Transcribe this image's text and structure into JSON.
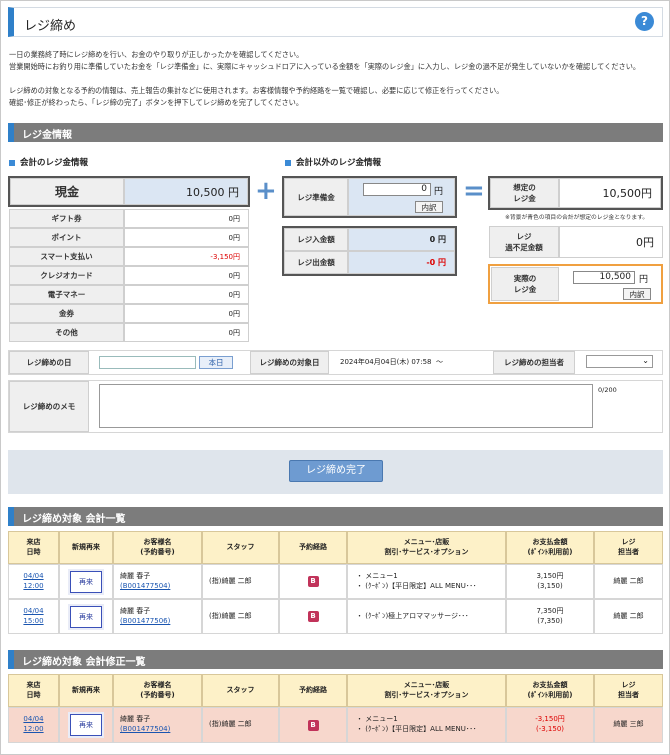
{
  "title": "レジ締め",
  "intro": [
    "一日の業務終了時にレジ締めを行い、お金のやり取りが正しかったかを確認してください。",
    "営業開始時にお釣り用に準備していたお金を「レジ準備金」に、実際にキャッシュドロアに入っている金額を「実際のレジ金」に入力し、レジ金の過不足が発生していないかを確認してください。",
    "レジ締めの対象となる予約の情報は、売上報告の集計などに使用されます。お客様情報や予約経路を一覧で確認し、必要に応じて修正を行ってください。",
    "確認･修正が終わったら、「レジ締の完了」ボタンを押下してレジ締めを完了してください。"
  ],
  "register_section": {
    "title": "レジ金情報",
    "accounting_title": "会計のレジ金情報",
    "non_accounting_title": "会計以外のレジ金情報",
    "cash_label": "現金",
    "cash_value": "10,500 円",
    "rows": [
      {
        "label": "ギフト券",
        "value": "0円"
      },
      {
        "label": "ポイント",
        "value": "0円"
      },
      {
        "label": "スマート支払い",
        "value": "-3,150円"
      },
      {
        "label": "クレジオカード",
        "value": "0円"
      },
      {
        "label": "電子マネー",
        "value": "0円"
      },
      {
        "label": "金券",
        "value": "0円"
      },
      {
        "label": "その他",
        "value": "0円"
      }
    ],
    "prep_label": "レジ準備金",
    "prep_value": "0",
    "yen": "円",
    "breakdown_label": "内訳",
    "deposit_label": "レジ入金額",
    "deposit_value": "0 円",
    "withdraw_label": "レジ出金額",
    "withdraw_value": "-0 円",
    "expected_label": "想定の\nレジ金",
    "expected_value": "10,500円",
    "expected_note": "※背景が青色の項目の合計が想定のレジ金となります。",
    "diff_label": "レジ\n過不足金額",
    "diff_value": "0円",
    "actual_label": "実際の\nレジ金",
    "actual_value": "10,500"
  },
  "close_info": {
    "date_label": "レジ締めの日",
    "date_value": "",
    "today_button": "本日",
    "target_label": "レジ締めの対象日",
    "target_value": "2024年04月04日(木) 07:58  ～",
    "staff_label": "レジ締めの担当者",
    "staff_value": "",
    "memo_label": "レジ締めのメモ",
    "memo_counter": "0/200"
  },
  "complete_button": "レジ締め完了",
  "list1": {
    "title": "レジ締め対象 会計一覧",
    "headers": [
      "来店\n日時",
      "新規再来",
      "お客様名\n(予約番号)",
      "スタッフ",
      "予約経路",
      "メニュー･店販\n割引･サービス･オプション",
      "お支払金額\n(ﾎﾟｲﾝﾄ利用前)",
      "レジ\n担当者"
    ],
    "rows": [
      {
        "date": "04/04",
        "time": "12:00",
        "type": "再来",
        "name": "綺麗 春子",
        "number": "(B001477504)",
        "staff": "(指)綺麗 二郎",
        "route": "B",
        "menus": [
          "・ メニュー1",
          "・ (ｸｰﾎﾟﾝ)【平日限定】ALL MENU･･･"
        ],
        "amount": "3,150円",
        "amount_sub": "(3,150)",
        "cashier": "綺麗 二郎"
      },
      {
        "date": "04/04",
        "time": "15:00",
        "type": "再来",
        "name": "綺麗 春子",
        "number": "(B001477506)",
        "staff": "(指)綺麗 二郎",
        "route": "B",
        "menus": [
          "・ (ｸｰﾎﾟﾝ)極上アロママッサージ･･･"
        ],
        "amount": "7,350円",
        "amount_sub": "(7,350)",
        "cashier": "綺麗 二郎"
      }
    ]
  },
  "list2": {
    "title": "レジ締め対象 会計修正一覧",
    "headers": [
      "来店\n日時",
      "新規再来",
      "お客様名\n(予約番号)",
      "スタッフ",
      "予約経路",
      "メニュー･店販\n割引･サービス･オプション",
      "お支払金額\n(ﾎﾟｲﾝﾄ利用前)",
      "レジ\n担当者"
    ],
    "rows": [
      {
        "date": "04/04",
        "time": "12:00",
        "type": "再来",
        "name": "綺麗 春子",
        "number": "(B001477504)",
        "staff": "(指)綺麗 二郎",
        "route": "B",
        "menus": [
          "・ メニュー1",
          "・ (ｸｰﾎﾟﾝ)【平日限定】ALL MENU･･･"
        ],
        "amount": "-3,150円",
        "amount_sub": "(-3,150)",
        "cashier": "綺麗 三郎"
      }
    ]
  },
  "colors": {
    "accent": "#2f80c9",
    "section_bg": "#7c7c7c",
    "table_header": "#fdf1c8",
    "highlight_row": "#f7d7cc",
    "negative": "#dd0000"
  }
}
